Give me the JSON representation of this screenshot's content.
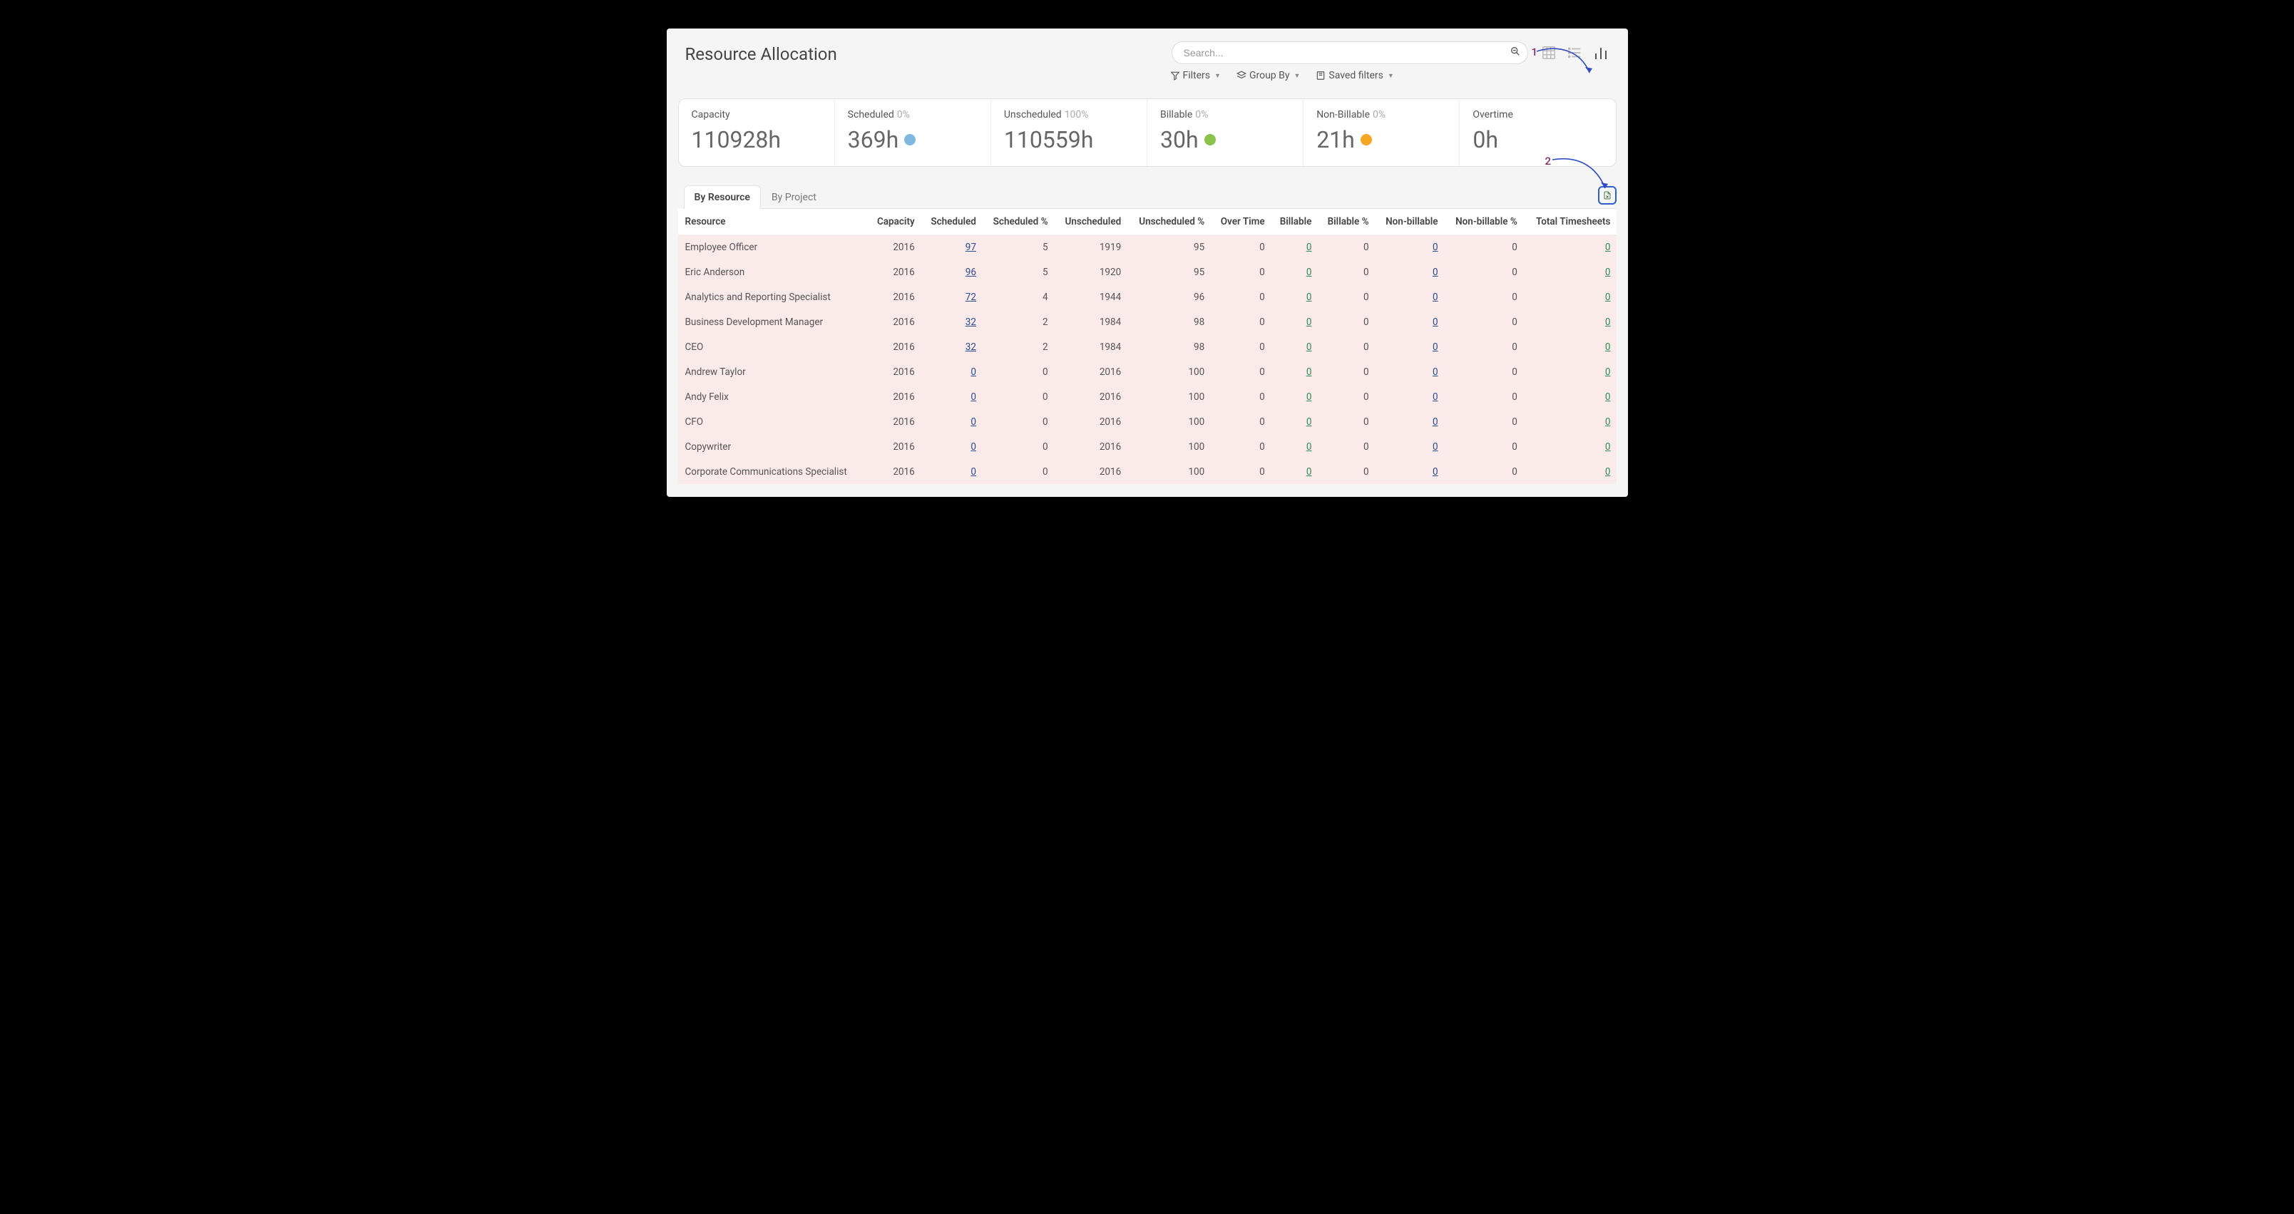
{
  "page": {
    "title": "Resource Allocation"
  },
  "search": {
    "placeholder": "Search..."
  },
  "toolbar": {
    "filters": "Filters",
    "group_by": "Group By",
    "saved_filters": "Saved filters"
  },
  "kpis": {
    "capacity": {
      "label": "Capacity",
      "value": "110928h"
    },
    "scheduled": {
      "label": "Scheduled",
      "pct": "0%",
      "value": "369h"
    },
    "unscheduled": {
      "label": "Unscheduled",
      "pct": "100%",
      "value": "110559h"
    },
    "billable": {
      "label": "Billable",
      "pct": "0%",
      "value": "30h"
    },
    "nonbillable": {
      "label": "Non-Billable",
      "pct": "0%",
      "value": "21h"
    },
    "overtime": {
      "label": "Overtime",
      "value": "0h"
    }
  },
  "tabs": {
    "by_resource": "By Resource",
    "by_project": "By Project"
  },
  "annotations": {
    "one": "1",
    "two": "2"
  },
  "table": {
    "columns": [
      "Resource",
      "Capacity",
      "Scheduled",
      "Scheduled %",
      "Unscheduled",
      "Unscheduled %",
      "Over Time",
      "Billable",
      "Billable %",
      "Non-billable",
      "Non-billable %",
      "Total Timesheets"
    ],
    "rows": [
      {
        "resource": "Employee Officer",
        "capacity": "2016",
        "scheduled": "97",
        "scheduled_pct": "5",
        "unscheduled": "1919",
        "unscheduled_pct": "95",
        "overtime": "0",
        "billable": "0",
        "billable_pct": "0",
        "nonbillable": "0",
        "nonbillable_pct": "0",
        "total": "0"
      },
      {
        "resource": "Eric Anderson",
        "capacity": "2016",
        "scheduled": "96",
        "scheduled_pct": "5",
        "unscheduled": "1920",
        "unscheduled_pct": "95",
        "overtime": "0",
        "billable": "0",
        "billable_pct": "0",
        "nonbillable": "0",
        "nonbillable_pct": "0",
        "total": "0"
      },
      {
        "resource": "Analytics and Reporting Specialist",
        "capacity": "2016",
        "scheduled": "72",
        "scheduled_pct": "4",
        "unscheduled": "1944",
        "unscheduled_pct": "96",
        "overtime": "0",
        "billable": "0",
        "billable_pct": "0",
        "nonbillable": "0",
        "nonbillable_pct": "0",
        "total": "0"
      },
      {
        "resource": "Business Development Manager",
        "capacity": "2016",
        "scheduled": "32",
        "scheduled_pct": "2",
        "unscheduled": "1984",
        "unscheduled_pct": "98",
        "overtime": "0",
        "billable": "0",
        "billable_pct": "0",
        "nonbillable": "0",
        "nonbillable_pct": "0",
        "total": "0"
      },
      {
        "resource": "CEO",
        "capacity": "2016",
        "scheduled": "32",
        "scheduled_pct": "2",
        "unscheduled": "1984",
        "unscheduled_pct": "98",
        "overtime": "0",
        "billable": "0",
        "billable_pct": "0",
        "nonbillable": "0",
        "nonbillable_pct": "0",
        "total": "0"
      },
      {
        "resource": "Andrew Taylor",
        "capacity": "2016",
        "scheduled": "0",
        "scheduled_pct": "0",
        "unscheduled": "2016",
        "unscheduled_pct": "100",
        "overtime": "0",
        "billable": "0",
        "billable_pct": "0",
        "nonbillable": "0",
        "nonbillable_pct": "0",
        "total": "0"
      },
      {
        "resource": "Andy Felix",
        "capacity": "2016",
        "scheduled": "0",
        "scheduled_pct": "0",
        "unscheduled": "2016",
        "unscheduled_pct": "100",
        "overtime": "0",
        "billable": "0",
        "billable_pct": "0",
        "nonbillable": "0",
        "nonbillable_pct": "0",
        "total": "0"
      },
      {
        "resource": "CFO",
        "capacity": "2016",
        "scheduled": "0",
        "scheduled_pct": "0",
        "unscheduled": "2016",
        "unscheduled_pct": "100",
        "overtime": "0",
        "billable": "0",
        "billable_pct": "0",
        "nonbillable": "0",
        "nonbillable_pct": "0",
        "total": "0"
      },
      {
        "resource": "Copywriter",
        "capacity": "2016",
        "scheduled": "0",
        "scheduled_pct": "0",
        "unscheduled": "2016",
        "unscheduled_pct": "100",
        "overtime": "0",
        "billable": "0",
        "billable_pct": "0",
        "nonbillable": "0",
        "nonbillable_pct": "0",
        "total": "0"
      },
      {
        "resource": "Corporate Communications Specialist",
        "capacity": "2016",
        "scheduled": "0",
        "scheduled_pct": "0",
        "unscheduled": "2016",
        "unscheduled_pct": "100",
        "overtime": "0",
        "billable": "0",
        "billable_pct": "0",
        "nonbillable": "0",
        "nonbillable_pct": "0",
        "total": "0"
      }
    ]
  }
}
